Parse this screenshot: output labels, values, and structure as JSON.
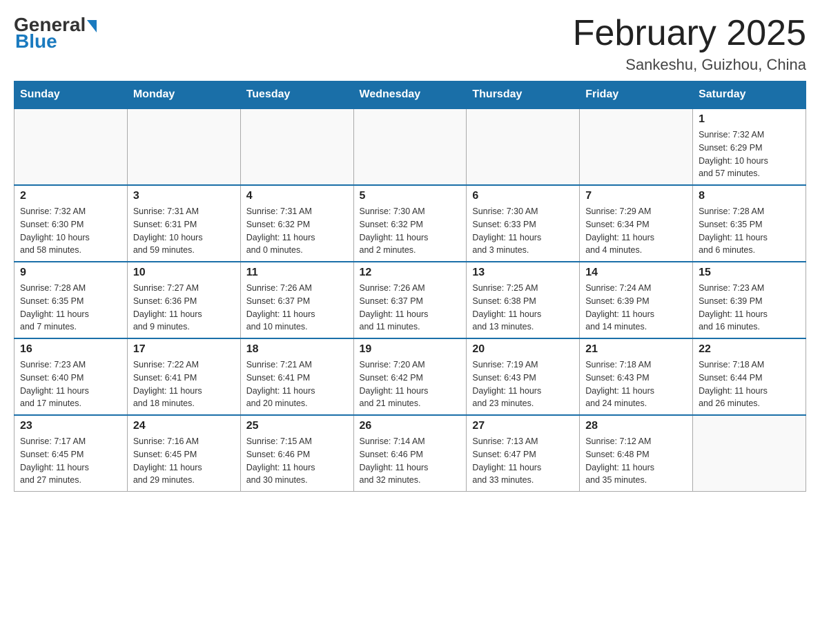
{
  "header": {
    "logo_general": "General",
    "logo_blue": "Blue",
    "month_title": "February 2025",
    "location": "Sankeshu, Guizhou, China"
  },
  "weekdays": [
    "Sunday",
    "Monday",
    "Tuesday",
    "Wednesday",
    "Thursday",
    "Friday",
    "Saturday"
  ],
  "weeks": [
    [
      {
        "day": "",
        "info": ""
      },
      {
        "day": "",
        "info": ""
      },
      {
        "day": "",
        "info": ""
      },
      {
        "day": "",
        "info": ""
      },
      {
        "day": "",
        "info": ""
      },
      {
        "day": "",
        "info": ""
      },
      {
        "day": "1",
        "info": "Sunrise: 7:32 AM\nSunset: 6:29 PM\nDaylight: 10 hours\nand 57 minutes."
      }
    ],
    [
      {
        "day": "2",
        "info": "Sunrise: 7:32 AM\nSunset: 6:30 PM\nDaylight: 10 hours\nand 58 minutes."
      },
      {
        "day": "3",
        "info": "Sunrise: 7:31 AM\nSunset: 6:31 PM\nDaylight: 10 hours\nand 59 minutes."
      },
      {
        "day": "4",
        "info": "Sunrise: 7:31 AM\nSunset: 6:32 PM\nDaylight: 11 hours\nand 0 minutes."
      },
      {
        "day": "5",
        "info": "Sunrise: 7:30 AM\nSunset: 6:32 PM\nDaylight: 11 hours\nand 2 minutes."
      },
      {
        "day": "6",
        "info": "Sunrise: 7:30 AM\nSunset: 6:33 PM\nDaylight: 11 hours\nand 3 minutes."
      },
      {
        "day": "7",
        "info": "Sunrise: 7:29 AM\nSunset: 6:34 PM\nDaylight: 11 hours\nand 4 minutes."
      },
      {
        "day": "8",
        "info": "Sunrise: 7:28 AM\nSunset: 6:35 PM\nDaylight: 11 hours\nand 6 minutes."
      }
    ],
    [
      {
        "day": "9",
        "info": "Sunrise: 7:28 AM\nSunset: 6:35 PM\nDaylight: 11 hours\nand 7 minutes."
      },
      {
        "day": "10",
        "info": "Sunrise: 7:27 AM\nSunset: 6:36 PM\nDaylight: 11 hours\nand 9 minutes."
      },
      {
        "day": "11",
        "info": "Sunrise: 7:26 AM\nSunset: 6:37 PM\nDaylight: 11 hours\nand 10 minutes."
      },
      {
        "day": "12",
        "info": "Sunrise: 7:26 AM\nSunset: 6:37 PM\nDaylight: 11 hours\nand 11 minutes."
      },
      {
        "day": "13",
        "info": "Sunrise: 7:25 AM\nSunset: 6:38 PM\nDaylight: 11 hours\nand 13 minutes."
      },
      {
        "day": "14",
        "info": "Sunrise: 7:24 AM\nSunset: 6:39 PM\nDaylight: 11 hours\nand 14 minutes."
      },
      {
        "day": "15",
        "info": "Sunrise: 7:23 AM\nSunset: 6:39 PM\nDaylight: 11 hours\nand 16 minutes."
      }
    ],
    [
      {
        "day": "16",
        "info": "Sunrise: 7:23 AM\nSunset: 6:40 PM\nDaylight: 11 hours\nand 17 minutes."
      },
      {
        "day": "17",
        "info": "Sunrise: 7:22 AM\nSunset: 6:41 PM\nDaylight: 11 hours\nand 18 minutes."
      },
      {
        "day": "18",
        "info": "Sunrise: 7:21 AM\nSunset: 6:41 PM\nDaylight: 11 hours\nand 20 minutes."
      },
      {
        "day": "19",
        "info": "Sunrise: 7:20 AM\nSunset: 6:42 PM\nDaylight: 11 hours\nand 21 minutes."
      },
      {
        "day": "20",
        "info": "Sunrise: 7:19 AM\nSunset: 6:43 PM\nDaylight: 11 hours\nand 23 minutes."
      },
      {
        "day": "21",
        "info": "Sunrise: 7:18 AM\nSunset: 6:43 PM\nDaylight: 11 hours\nand 24 minutes."
      },
      {
        "day": "22",
        "info": "Sunrise: 7:18 AM\nSunset: 6:44 PM\nDaylight: 11 hours\nand 26 minutes."
      }
    ],
    [
      {
        "day": "23",
        "info": "Sunrise: 7:17 AM\nSunset: 6:45 PM\nDaylight: 11 hours\nand 27 minutes."
      },
      {
        "day": "24",
        "info": "Sunrise: 7:16 AM\nSunset: 6:45 PM\nDaylight: 11 hours\nand 29 minutes."
      },
      {
        "day": "25",
        "info": "Sunrise: 7:15 AM\nSunset: 6:46 PM\nDaylight: 11 hours\nand 30 minutes."
      },
      {
        "day": "26",
        "info": "Sunrise: 7:14 AM\nSunset: 6:46 PM\nDaylight: 11 hours\nand 32 minutes."
      },
      {
        "day": "27",
        "info": "Sunrise: 7:13 AM\nSunset: 6:47 PM\nDaylight: 11 hours\nand 33 minutes."
      },
      {
        "day": "28",
        "info": "Sunrise: 7:12 AM\nSunset: 6:48 PM\nDaylight: 11 hours\nand 35 minutes."
      },
      {
        "day": "",
        "info": ""
      }
    ]
  ]
}
